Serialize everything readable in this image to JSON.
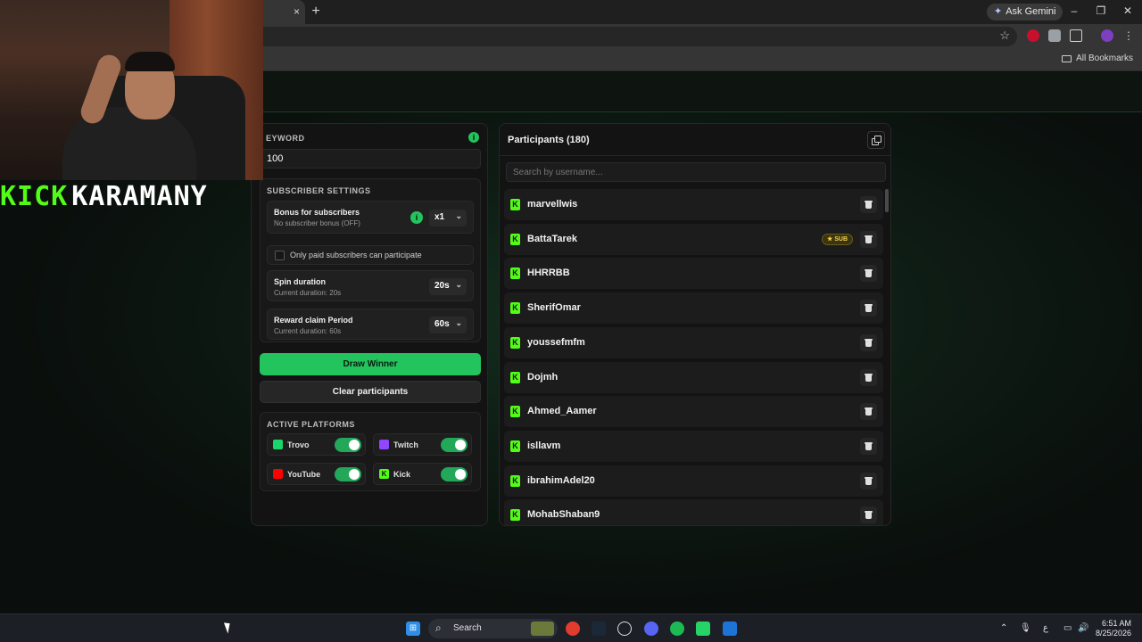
{
  "browser": {
    "ask_gemini_label": "Ask Gemini",
    "all_bookmarks_label": "All Bookmarks",
    "new_tab_symbol": "+",
    "close_tab_symbol": "×"
  },
  "overlay": {
    "logo_part1": "KICK",
    "logo_part2": "KARAMANY"
  },
  "left_panel": {
    "keyword_label": "EYWORD",
    "keyword_value": "100",
    "subscriber_settings_title": "SUBSCRIBER SETTINGS",
    "bonus": {
      "title": "Bonus for subscribers",
      "subtitle": "No subscriber bonus (OFF)",
      "value": "x1"
    },
    "only_paid_label": "Only paid subscribers can participate",
    "spin_duration": {
      "title": "Spin duration",
      "subtitle": "Current duration: 20s",
      "value": "20s"
    },
    "reward_claim": {
      "title": "Reward claim Period",
      "subtitle": "Current duration: 60s",
      "value": "60s"
    },
    "draw_winner_label": "Draw Winner",
    "clear_participants_label": "Clear participants",
    "active_platforms_title": "ACTIVE PLATFORMS",
    "platforms": [
      {
        "name": "Trovo",
        "enabled": true,
        "color": "#19d66b"
      },
      {
        "name": "Twitch",
        "enabled": true,
        "color": "#9146ff"
      },
      {
        "name": "YouTube",
        "enabled": true,
        "color": "#ff0000"
      },
      {
        "name": "Kick",
        "enabled": true,
        "color": "#53fc18"
      }
    ]
  },
  "participants": {
    "title": "Participants (180)",
    "search_placeholder": "Search by username...",
    "sub_badge_label": "SUB",
    "items": [
      {
        "name": "marvellwis",
        "sub": false
      },
      {
        "name": "BattaTarek",
        "sub": true
      },
      {
        "name": "HHRRBB",
        "sub": false
      },
      {
        "name": "SherifOmar",
        "sub": false
      },
      {
        "name": "youssefmfm",
        "sub": false
      },
      {
        "name": "Dojmh",
        "sub": false
      },
      {
        "name": "Ahmed_Aamer",
        "sub": false
      },
      {
        "name": "isllavm",
        "sub": false
      },
      {
        "name": "ibrahimAdel20",
        "sub": false
      },
      {
        "name": "MohabShaban9",
        "sub": false
      }
    ]
  },
  "taskbar": {
    "search_label": "Search",
    "time": "6:51 AM",
    "date": "8/25/2026",
    "lang": "ع"
  },
  "colors": {
    "accent": "#23c45e",
    "kick_green": "#53fc18",
    "panel_bg": "#131313"
  }
}
